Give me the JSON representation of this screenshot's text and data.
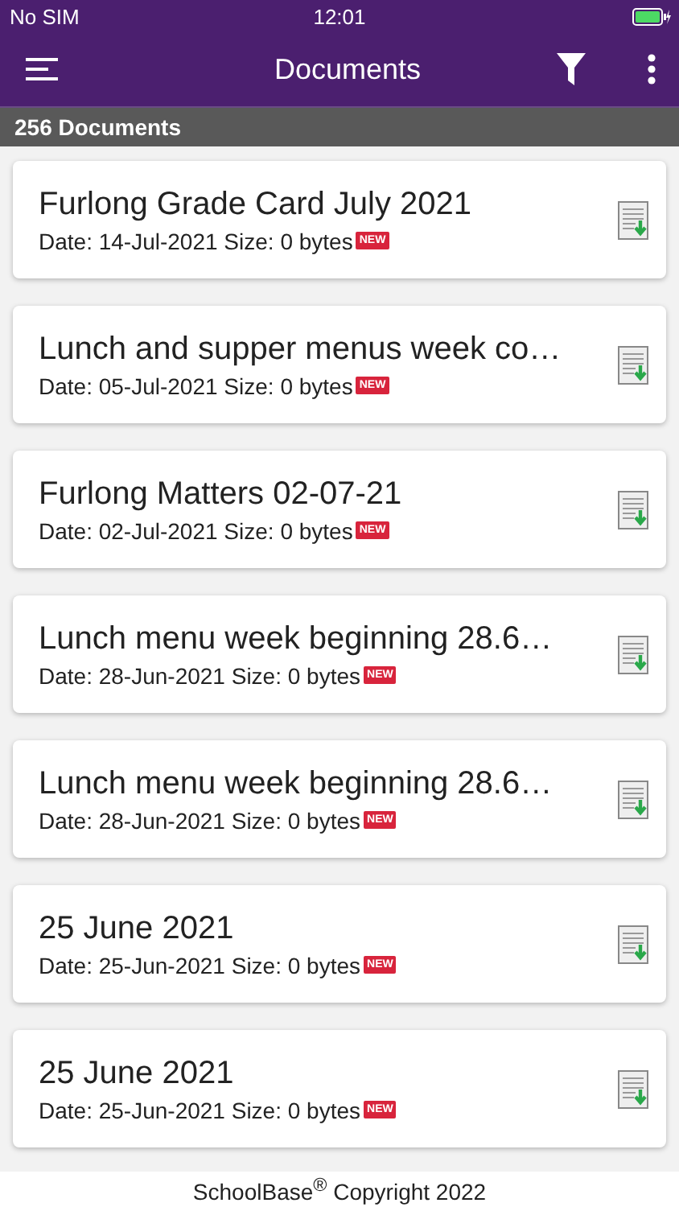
{
  "status_bar": {
    "carrier": "No SIM",
    "time": "12:01"
  },
  "nav_bar": {
    "title": "Documents"
  },
  "count_bar": {
    "label": "256 Documents"
  },
  "documents": [
    {
      "title": "Furlong Grade Card July 2021",
      "meta": "Date: 14-Jul-2021 Size: 0 bytes",
      "badge": "NEW"
    },
    {
      "title": "Lunch and supper menus week co…",
      "meta": "Date: 05-Jul-2021 Size: 0 bytes",
      "badge": "NEW"
    },
    {
      "title": "Furlong Matters 02-07-21",
      "meta": "Date: 02-Jul-2021 Size: 0 bytes",
      "badge": "NEW"
    },
    {
      "title": "Lunch menu week beginning 28.6…",
      "meta": "Date: 28-Jun-2021 Size: 0 bytes",
      "badge": "NEW"
    },
    {
      "title": "Lunch menu week beginning 28.6…",
      "meta": "Date: 28-Jun-2021 Size: 0 bytes",
      "badge": "NEW"
    },
    {
      "title": "25 June 2021",
      "meta": "Date: 25-Jun-2021 Size: 0 bytes",
      "badge": "NEW"
    },
    {
      "title": "25 June 2021",
      "meta": "Date: 25-Jun-2021 Size: 0 bytes",
      "badge": "NEW"
    }
  ],
  "footer": "SchoolBase$^{®}$ Copyright 2022"
}
